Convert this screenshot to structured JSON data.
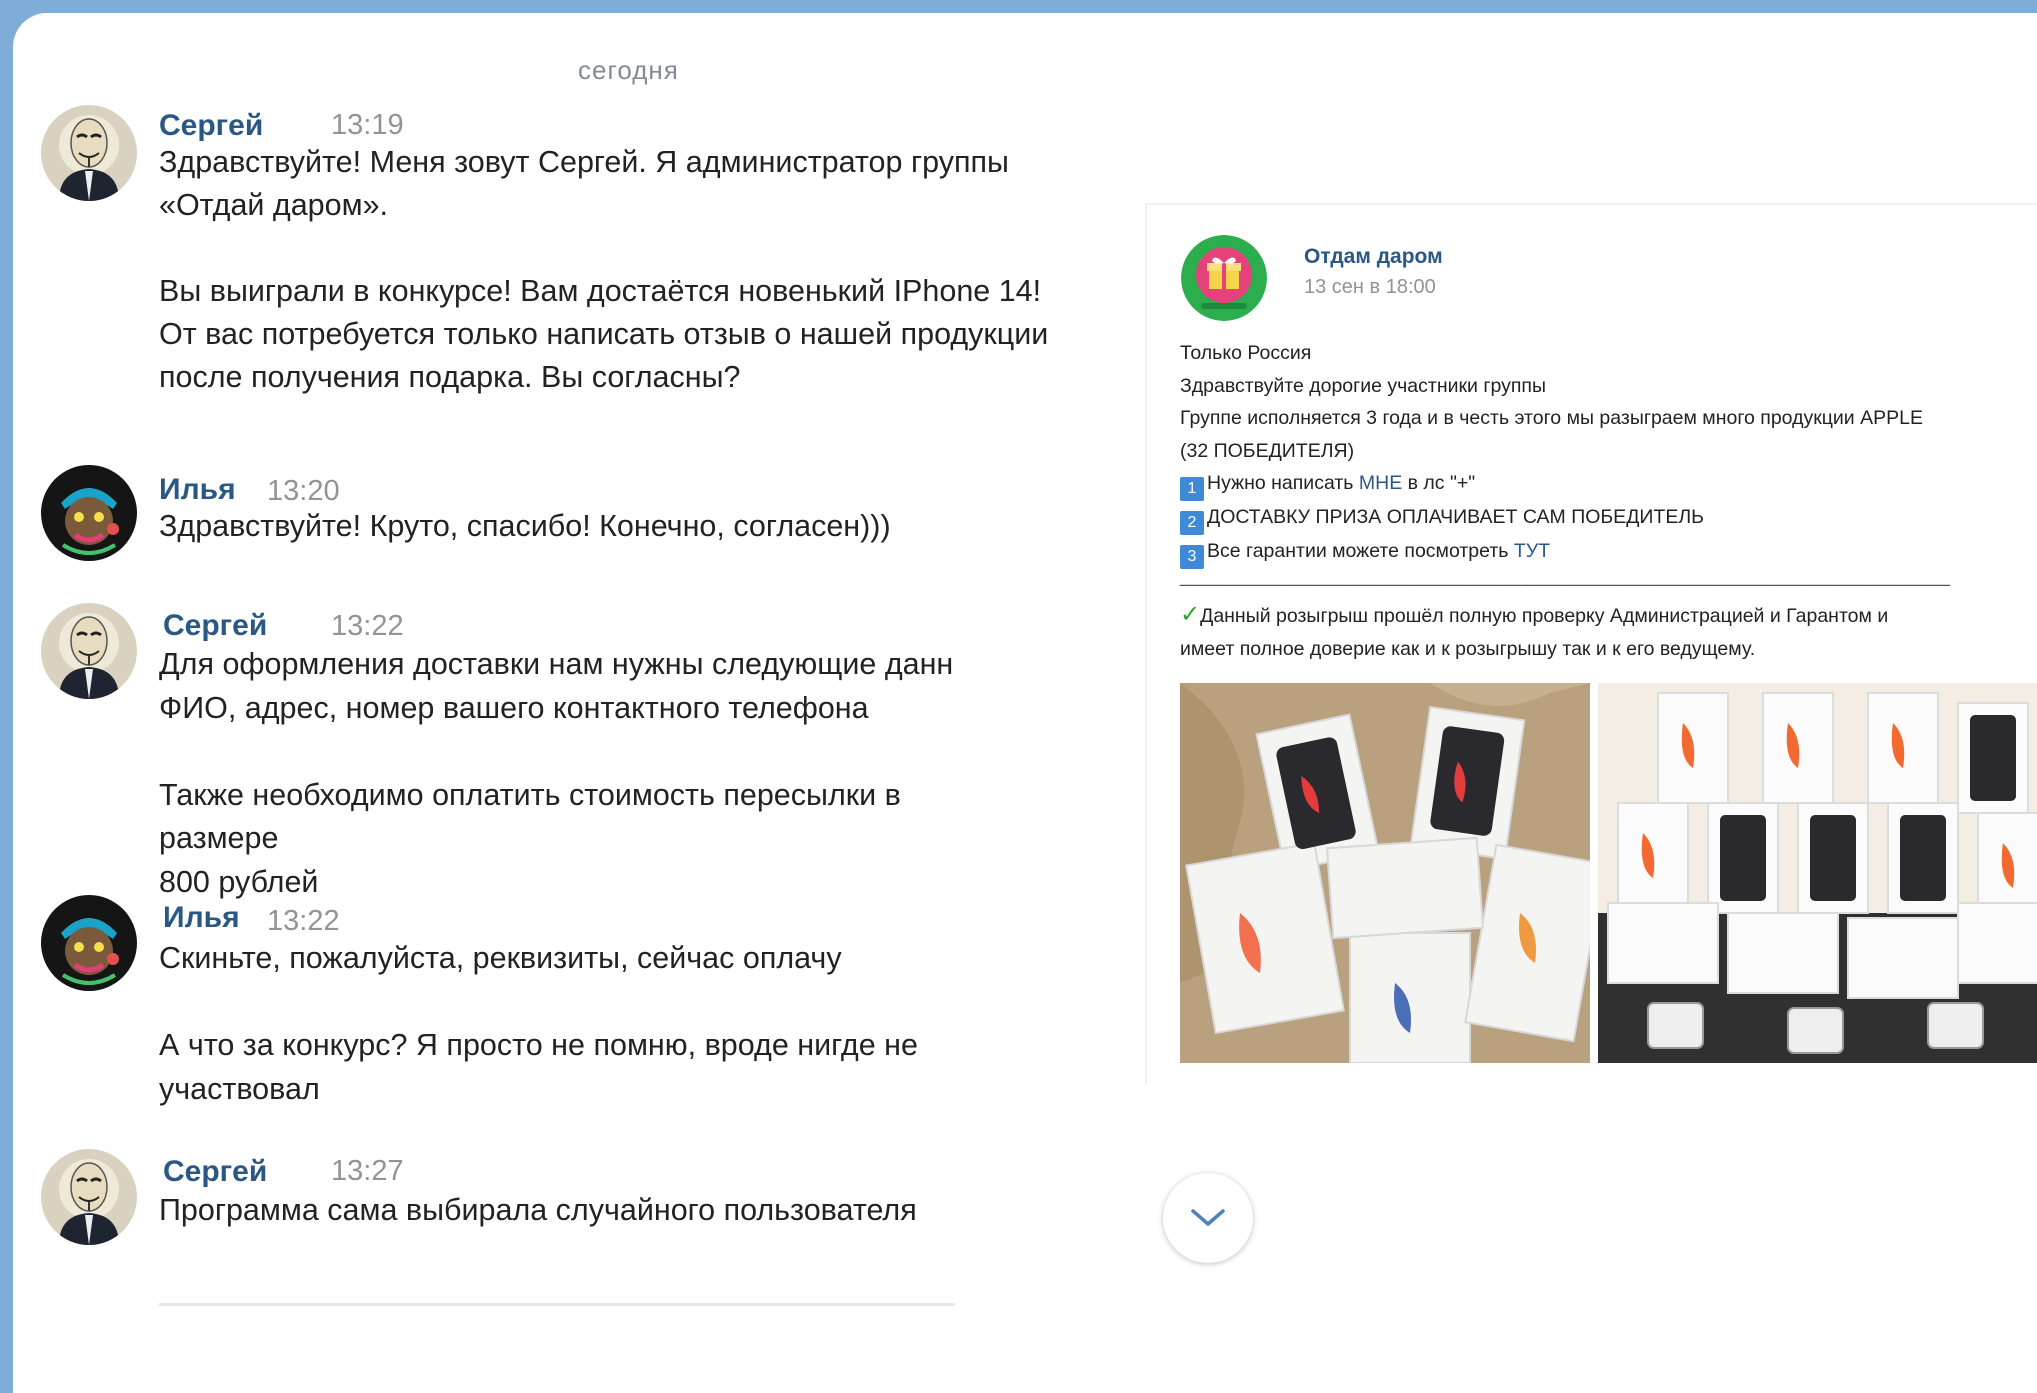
{
  "chat": {
    "date_separator": "сегодня",
    "messages": [
      {
        "author": "Сергей",
        "time": "13:19",
        "avatar_icon": "anonymous-mask-avatar",
        "text": "Здравствуйте! Меня зовут Сергей. Я администратор группы\n«Отдай даром».\n\nВы выиграли в конкурсе! Вам достаётся новенький IPhone 14!\nОт вас потребуется только написать отзыв о нашей продукции\nпосле получения подарка. Вы согласны?"
      },
      {
        "author": "Илья",
        "time": "13:20",
        "avatar_icon": "monkey-art-avatar",
        "text": "Здравствуйте! Круто, спасибо! Конечно, согласен)))"
      },
      {
        "author": "Сергей",
        "time": "13:22",
        "avatar_icon": "anonymous-mask-avatar",
        "text": "Для оформления доставки нам нужны следующие данн\nФИО, адрес, номер вашего контактного телефона\n\nТакже необходимо оплатить стоимость пересылки в размере\n800 рублей"
      },
      {
        "author": "Илья",
        "time": "13:22",
        "avatar_icon": "monkey-art-avatar",
        "text": "Скиньте, пожалуйста, реквизиты, сейчас оплачу\n\nА что за конкурс? Я просто не помню, вроде нигде не\nучаствовал"
      },
      {
        "author": "Сергей",
        "time": "13:27",
        "avatar_icon": "anonymous-mask-avatar",
        "text": "Программа сама выбирала случайного пользователя"
      }
    ]
  },
  "post": {
    "group_name": "Отдам даром",
    "date": "13 сен в 18:00",
    "avatar_icon": "gift-box-icon",
    "lines": {
      "l1": "Только Россия",
      "l2": "Здравствуйте дорогие участники группы",
      "l3": "Группе исполняется 3 года и в честь этого мы разыграем много продукции APPLE",
      "l4": "(32 ПОБЕДИТЕЛЯ)",
      "n1": "1",
      "l5a": "Нужно написать ",
      "l5link": "МНЕ",
      "l5b": " в лс \"+\"",
      "n2": "2",
      "l6": "ДОСТАВКУ ПРИЗА ОПЛАЧИВАЕТ САМ ПОБЕДИТЕЛЬ",
      "n3": "3",
      "l7a": "Все гарантии можете посмотреть ",
      "l7link": "ТУТ",
      "sep": "_______________________________________________________________________",
      "check": "✓",
      "l8": "Данный розыгрыш прошёл полную проверку Администрацией и Гарантом и",
      "l9": "имеет полное доверие как и к розыгрышу так и к его ведущему."
    },
    "photos": [
      "iphone-boxes-photo",
      "iphone-boxes-display-photo"
    ]
  },
  "colors": {
    "link": "#2a5885",
    "background": "#7eaed7",
    "number_badge": "#3f8ad6",
    "check": "#2aa52a"
  },
  "scroll_button_icon": "chevron-down-icon"
}
